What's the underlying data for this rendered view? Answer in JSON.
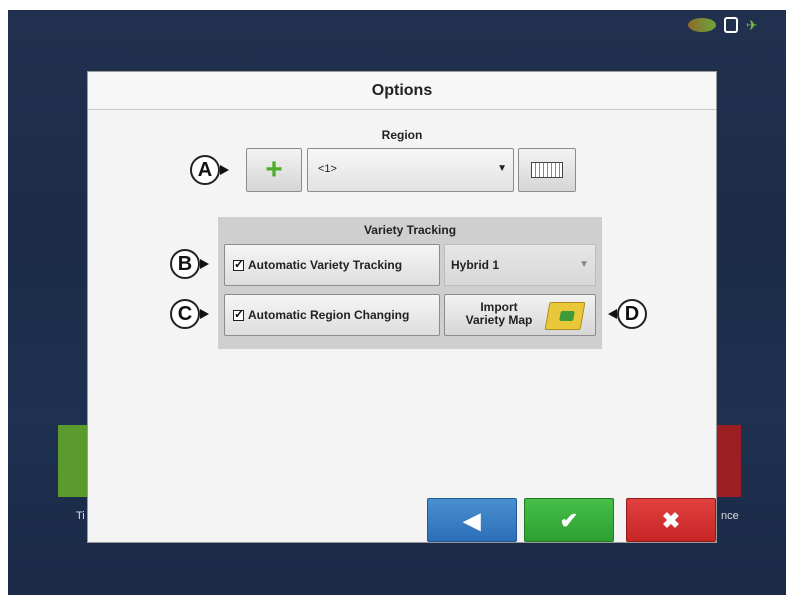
{
  "dialog": {
    "title": "Options",
    "region": {
      "label": "Region",
      "selected": "<1>",
      "add_icon": "plus-icon",
      "keyboard_icon": "keyboard-icon"
    },
    "variety_tracking": {
      "title": "Variety Tracking",
      "auto_variety_label": "Automatic Variety Tracking",
      "auto_variety_checked": true,
      "hybrid_selected": "Hybrid 1",
      "auto_region_label": "Automatic Region Changing",
      "auto_region_checked": true,
      "import_label_line1": "Import",
      "import_label_line2": "Variety Map",
      "import_icon": "folder-import-icon"
    },
    "buttons": {
      "back_glyph": "◀",
      "ok_glyph": "✔",
      "cancel_glyph": "✖"
    }
  },
  "callouts": {
    "a": "A",
    "b": "B",
    "c": "C",
    "d": "D"
  },
  "background": {
    "left_tile_text": "Ti",
    "right_tile_text": "nce"
  },
  "colors": {
    "back": "#2c6fb8",
    "ok": "#2ea032",
    "cancel": "#c62626",
    "plus": "#4caf2a"
  }
}
